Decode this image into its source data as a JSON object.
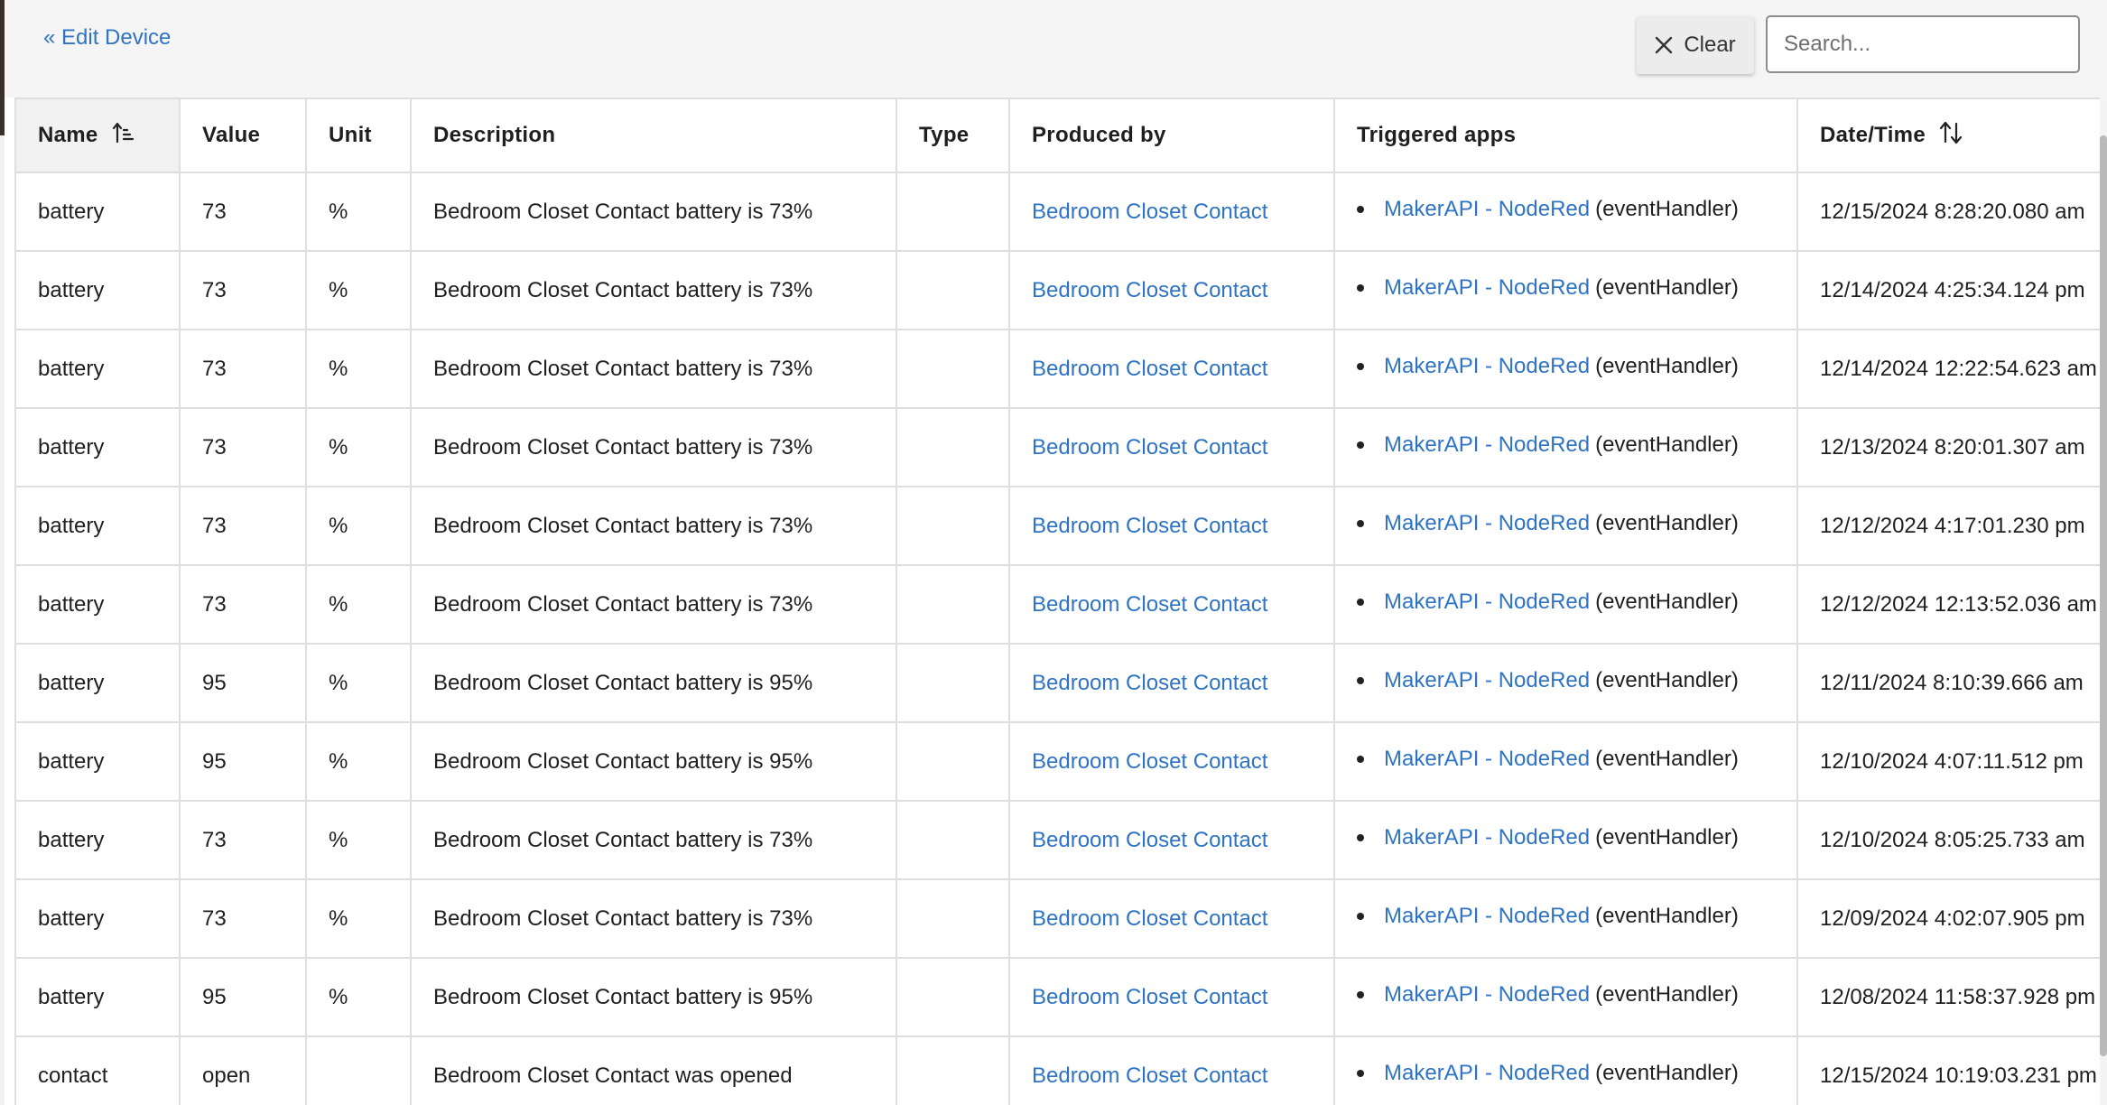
{
  "header": {
    "back_link": "« Edit Device",
    "clear_label": "Clear",
    "search_placeholder": "Search...",
    "search_value": ""
  },
  "table": {
    "columns": {
      "name": "Name",
      "value": "Value",
      "unit": "Unit",
      "description": "Description",
      "type": "Type",
      "produced_by": "Produced by",
      "triggered_apps": "Triggered apps",
      "datetime": "Date/Time"
    },
    "rows": [
      {
        "name": "battery",
        "value": "73",
        "unit": "%",
        "description": "Bedroom Closet Contact battery is 73%",
        "type": "",
        "produced_by": "Bedroom Closet Contact",
        "app": "MakerAPI - NodeRed",
        "handler": "(eventHandler)",
        "datetime": "12/15/2024 8:28:20.080 am"
      },
      {
        "name": "battery",
        "value": "73",
        "unit": "%",
        "description": "Bedroom Closet Contact battery is 73%",
        "type": "",
        "produced_by": "Bedroom Closet Contact",
        "app": "MakerAPI - NodeRed",
        "handler": "(eventHandler)",
        "datetime": "12/14/2024 4:25:34.124 pm"
      },
      {
        "name": "battery",
        "value": "73",
        "unit": "%",
        "description": "Bedroom Closet Contact battery is 73%",
        "type": "",
        "produced_by": "Bedroom Closet Contact",
        "app": "MakerAPI - NodeRed",
        "handler": "(eventHandler)",
        "datetime": "12/14/2024 12:22:54.623 am"
      },
      {
        "name": "battery",
        "value": "73",
        "unit": "%",
        "description": "Bedroom Closet Contact battery is 73%",
        "type": "",
        "produced_by": "Bedroom Closet Contact",
        "app": "MakerAPI - NodeRed",
        "handler": "(eventHandler)",
        "datetime": "12/13/2024 8:20:01.307 am"
      },
      {
        "name": "battery",
        "value": "73",
        "unit": "%",
        "description": "Bedroom Closet Contact battery is 73%",
        "type": "",
        "produced_by": "Bedroom Closet Contact",
        "app": "MakerAPI - NodeRed",
        "handler": "(eventHandler)",
        "datetime": "12/12/2024 4:17:01.230 pm"
      },
      {
        "name": "battery",
        "value": "73",
        "unit": "%",
        "description": "Bedroom Closet Contact battery is 73%",
        "type": "",
        "produced_by": "Bedroom Closet Contact",
        "app": "MakerAPI - NodeRed",
        "handler": "(eventHandler)",
        "datetime": "12/12/2024 12:13:52.036 am"
      },
      {
        "name": "battery",
        "value": "95",
        "unit": "%",
        "description": "Bedroom Closet Contact battery is 95%",
        "type": "",
        "produced_by": "Bedroom Closet Contact",
        "app": "MakerAPI - NodeRed",
        "handler": "(eventHandler)",
        "datetime": "12/11/2024 8:10:39.666 am"
      },
      {
        "name": "battery",
        "value": "95",
        "unit": "%",
        "description": "Bedroom Closet Contact battery is 95%",
        "type": "",
        "produced_by": "Bedroom Closet Contact",
        "app": "MakerAPI - NodeRed",
        "handler": "(eventHandler)",
        "datetime": "12/10/2024 4:07:11.512 pm"
      },
      {
        "name": "battery",
        "value": "73",
        "unit": "%",
        "description": "Bedroom Closet Contact battery is 73%",
        "type": "",
        "produced_by": "Bedroom Closet Contact",
        "app": "MakerAPI - NodeRed",
        "handler": "(eventHandler)",
        "datetime": "12/10/2024 8:05:25.733 am"
      },
      {
        "name": "battery",
        "value": "73",
        "unit": "%",
        "description": "Bedroom Closet Contact battery is 73%",
        "type": "",
        "produced_by": "Bedroom Closet Contact",
        "app": "MakerAPI - NodeRed",
        "handler": "(eventHandler)",
        "datetime": "12/09/2024 4:02:07.905 pm"
      },
      {
        "name": "battery",
        "value": "95",
        "unit": "%",
        "description": "Bedroom Closet Contact battery is 95%",
        "type": "",
        "produced_by": "Bedroom Closet Contact",
        "app": "MakerAPI - NodeRed",
        "handler": "(eventHandler)",
        "datetime": "12/08/2024 11:58:37.928 pm"
      },
      {
        "name": "contact",
        "value": "open",
        "unit": "",
        "description": "Bedroom Closet Contact was opened",
        "type": "",
        "produced_by": "Bedroom Closet Contact",
        "app": "MakerAPI - NodeRed",
        "handler": "(eventHandler)",
        "datetime": "12/15/2024 10:19:03.231 pm"
      }
    ]
  },
  "icons": {
    "close": "close-icon",
    "sort_ascending": "sort-ascending-icon",
    "sort_both": "sort-both-icon"
  },
  "colors": {
    "link": "#2f73c4",
    "topbar_bg": "#f5f5f5",
    "border": "#dedede",
    "sorted_header_bg": "#f1f1f1"
  }
}
